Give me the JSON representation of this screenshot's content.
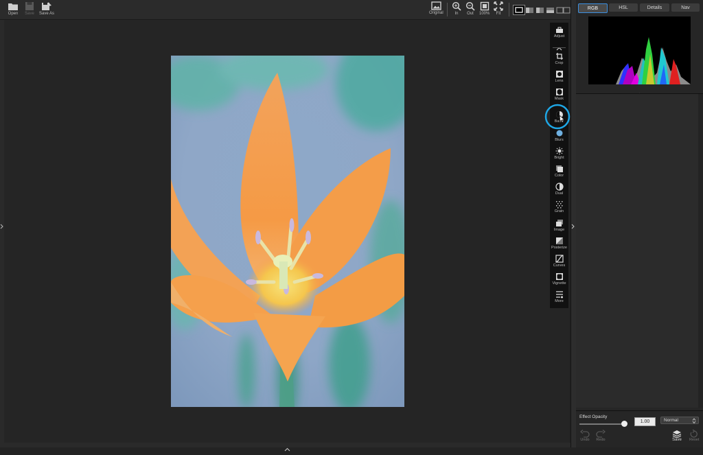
{
  "toolbar": {
    "open_label": "Open",
    "save_label": "Save",
    "saveas_label": "Save As",
    "original_label": "Original",
    "zoom_in_label": "In",
    "zoom_out_label": "Out",
    "zoom_100_label": "100%",
    "zoom_fit_label": "Fit"
  },
  "tools": [
    {
      "label": "Adjust",
      "icon": "toolbox-icon"
    },
    {
      "label": "Crop",
      "icon": "crop-icon"
    },
    {
      "label": "Lens",
      "icon": "lens-icon"
    },
    {
      "label": "Mask",
      "icon": "mask-icon"
    },
    {
      "label": "Basic",
      "icon": "basic-icon"
    },
    {
      "label": "Blurs",
      "icon": "blur-icon"
    },
    {
      "label": "Bright",
      "icon": "sun-icon"
    },
    {
      "label": "Color",
      "icon": "color-icon"
    },
    {
      "label": "Dual",
      "icon": "dual-icon"
    },
    {
      "label": "Grain",
      "icon": "grain-icon"
    },
    {
      "label": "Image",
      "icon": "image-icon"
    },
    {
      "label": "Posterize",
      "icon": "posterize-icon"
    },
    {
      "label": "Curves",
      "icon": "curves-icon"
    },
    {
      "label": "Vignette",
      "icon": "vignette-icon"
    },
    {
      "label": "More",
      "icon": "more-icon"
    }
  ],
  "panel_tabs": [
    {
      "label": "RGB",
      "active": true
    },
    {
      "label": "HSL",
      "active": false
    },
    {
      "label": "Details",
      "active": false
    },
    {
      "label": "Nav",
      "active": false
    }
  ],
  "effect": {
    "opacity_label": "Effect Opacity",
    "opacity_value": "1.00",
    "blend_mode": "Normal"
  },
  "footer": {
    "undo_label": "Undo",
    "redo_label": "Redo",
    "save_label": "Save",
    "reset_label": "Reset"
  },
  "colors": {
    "accent": "#3b8fe0",
    "highlight_ring": "#1ea7e6"
  }
}
